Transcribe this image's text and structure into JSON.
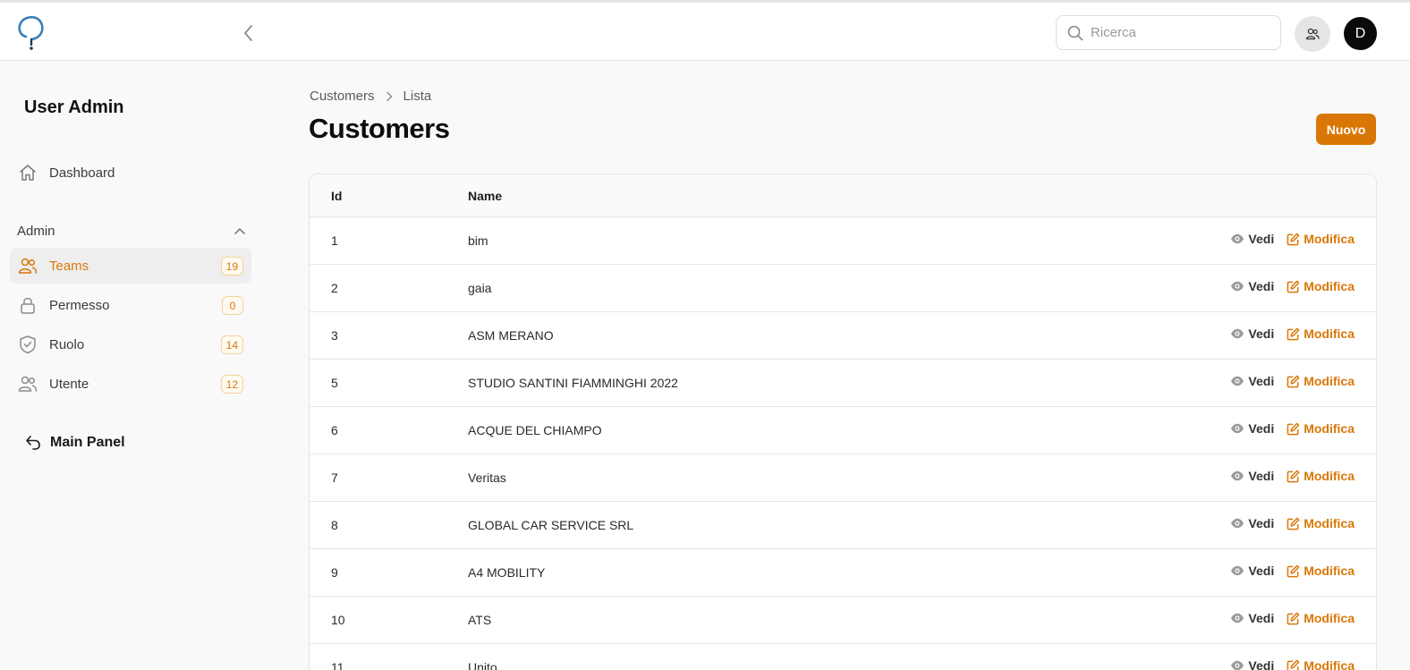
{
  "header": {
    "search_placeholder": "Ricerca",
    "avatar_initial": "D"
  },
  "sidebar": {
    "title": "User Admin",
    "dashboard_label": "Dashboard",
    "group_label": "Admin",
    "items": [
      {
        "label": "Teams",
        "count": "19",
        "icon": "users-icon",
        "active": true
      },
      {
        "label": "Permesso",
        "count": "0",
        "icon": "lock-icon",
        "active": false
      },
      {
        "label": "Ruolo",
        "count": "14",
        "icon": "shield-check-icon",
        "active": false
      },
      {
        "label": "Utente",
        "count": "12",
        "icon": "users-icon",
        "active": false
      }
    ],
    "main_panel_label": "Main Panel"
  },
  "breadcrumb": {
    "items": [
      "Customers",
      "Lista"
    ]
  },
  "page": {
    "title": "Customers",
    "new_button": "Nuovo"
  },
  "table": {
    "columns": [
      "Id",
      "Name"
    ],
    "view_label": "Vedi",
    "edit_label": "Modifica",
    "rows": [
      {
        "id": "1",
        "name": "bim"
      },
      {
        "id": "2",
        "name": "gaia"
      },
      {
        "id": "3",
        "name": "ASM MERANO"
      },
      {
        "id": "5",
        "name": "STUDIO SANTINI FIAMMINGHI 2022"
      },
      {
        "id": "6",
        "name": "ACQUE DEL CHIAMPO"
      },
      {
        "id": "7",
        "name": "Veritas"
      },
      {
        "id": "8",
        "name": "GLOBAL CAR SERVICE SRL"
      },
      {
        "id": "9",
        "name": "A4 MOBILITY"
      },
      {
        "id": "10",
        "name": "ATS"
      },
      {
        "id": "11",
        "name": "Unito"
      }
    ]
  },
  "colors": {
    "accent": "#d97706",
    "active_bg": "#eeeeee"
  }
}
